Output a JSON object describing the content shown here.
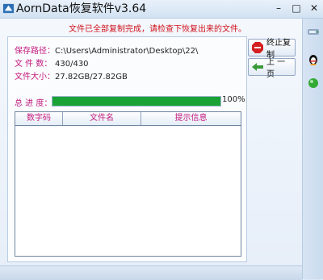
{
  "window": {
    "title": "AornData恢复软件v3.64"
  },
  "status_message": "文件已全部复制完成，请检查下恢复出来的文件。",
  "info": {
    "save_path_label": "保存路径：",
    "save_path_value": "C:\\Users\\Administrator\\Desktop\\22\\",
    "file_count_label": "文 件 数：",
    "file_count_value": "430/430",
    "file_size_label": "文件大小：",
    "file_size_value": "27.82GB/27.82GB",
    "progress_label": "总 进 度：",
    "progress_percent_text": "100%",
    "progress_fraction": 1.0
  },
  "table": {
    "columns": [
      "数字码",
      "文件名",
      "提示信息"
    ],
    "rows": []
  },
  "buttons": {
    "stop_copy_label": "终止复制",
    "prev_page_label": "上 一 页"
  },
  "colors": {
    "label": "#c2187d",
    "status": "#d0101c",
    "progress": "#1aa236",
    "accent": "#2c6fb5"
  },
  "icons": {
    "app": "app-icon",
    "stop": "stop-sign-icon",
    "prev": "back-arrow-icon",
    "right_bar": [
      "disk-icon",
      "qq-penguin-icon",
      "green-ball-icon"
    ]
  }
}
